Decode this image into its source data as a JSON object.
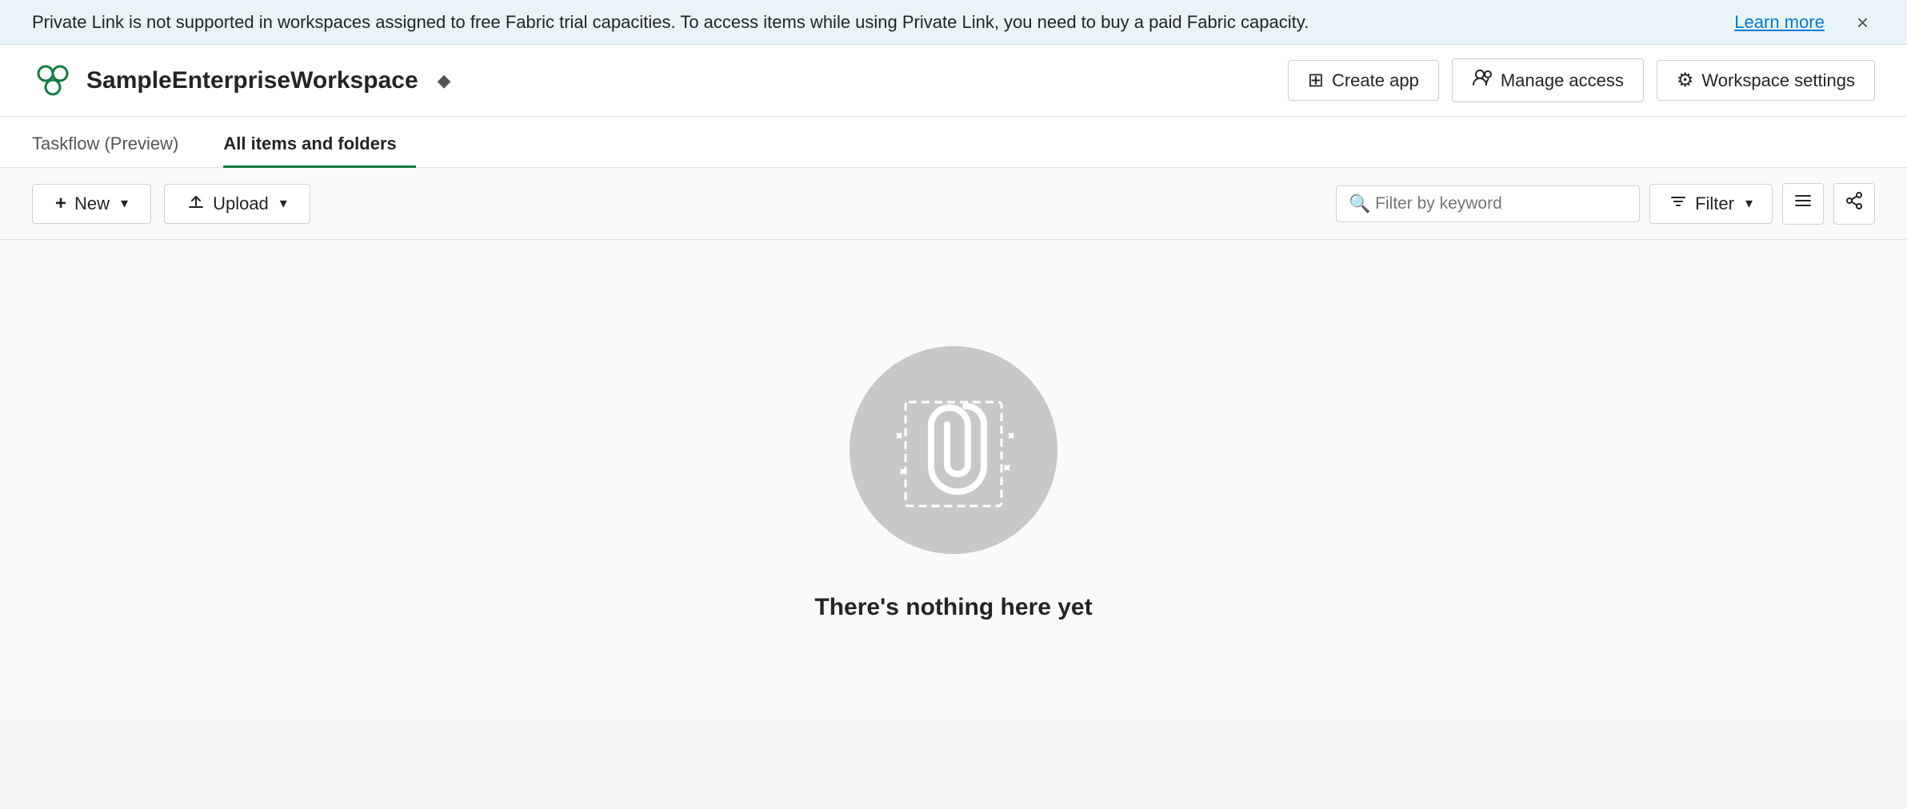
{
  "banner": {
    "message": "Private Link is not supported in workspaces assigned to free Fabric trial capacities. To access items while using Private Link, you need to buy a paid Fabric capacity.",
    "learn_more": "Learn more",
    "close_label": "×"
  },
  "header": {
    "workspace_name": "SampleEnterpriseWorkspace",
    "create_app_label": "Create app",
    "manage_access_label": "Manage access",
    "workspace_settings_label": "Workspace settings"
  },
  "tabs": [
    {
      "id": "taskflow",
      "label": "Taskflow (Preview)",
      "active": false
    },
    {
      "id": "all-items",
      "label": "All items and folders",
      "active": true
    }
  ],
  "toolbar": {
    "new_label": "New",
    "upload_label": "Upload",
    "filter_placeholder": "Filter by keyword",
    "filter_label": "Filter"
  },
  "main": {
    "empty_title": "There's nothing here yet"
  },
  "icons": {
    "plus": "+",
    "upload_arrow": "↑",
    "search": "⌕",
    "filter_lines": "≡",
    "chevron_down": "⌵",
    "view_toggle": "☰",
    "share": "⎇",
    "diamond": "◆",
    "create_app_icon": "🎁",
    "manage_access_icon": "👥",
    "settings_icon": "⚙"
  }
}
